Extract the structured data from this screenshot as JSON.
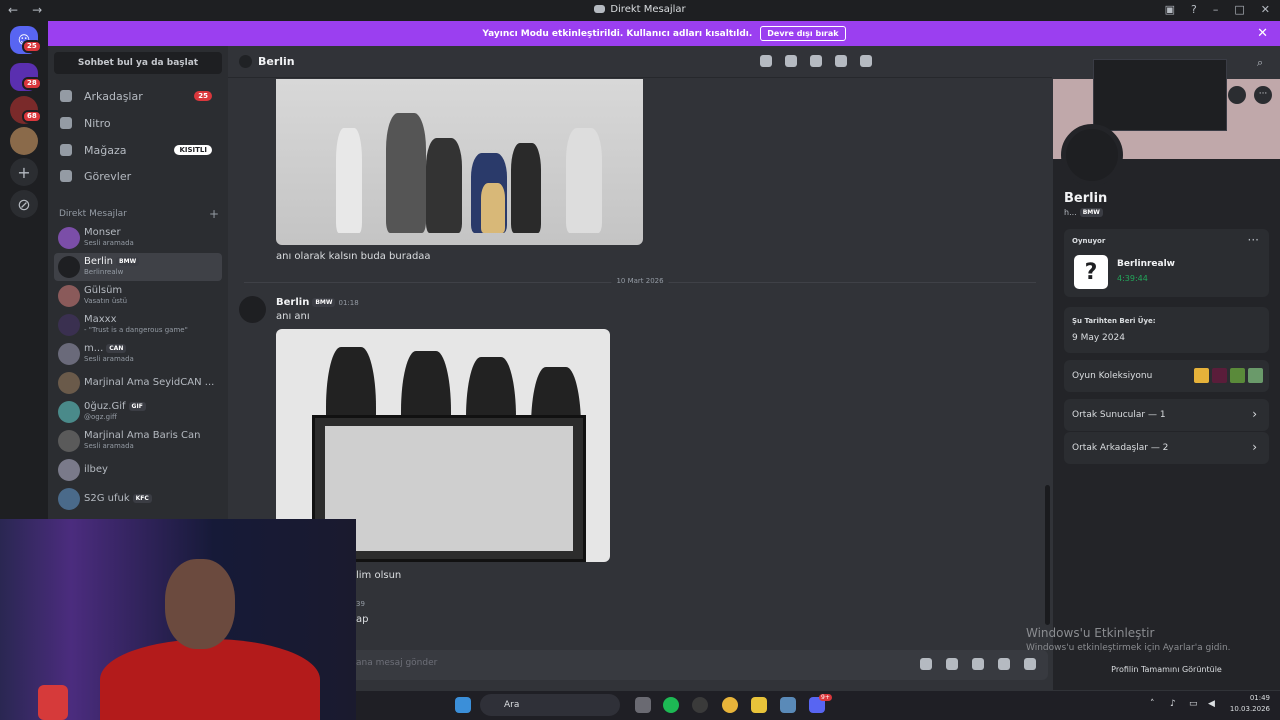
{
  "window": {
    "title": "Direkt Mesajlar"
  },
  "banner": {
    "text": "Yayıncı Modu etkinleştirildi. Kullanıcı adları kısaltıldı.",
    "button": "Devre dışı bırak"
  },
  "rail": {
    "badges": [
      "25",
      "28",
      "68"
    ]
  },
  "sidebar": {
    "search": "Sohbet bul ya da başlat",
    "nav": [
      {
        "label": "Arkadaşlar",
        "badge": "25"
      },
      {
        "label": "Nitro"
      },
      {
        "label": "Mağaza",
        "badge": "KISITLI"
      },
      {
        "label": "Görevler"
      }
    ],
    "section": "Direkt Mesajlar",
    "dms": [
      {
        "name": "Monser",
        "status": "Sesli aramada"
      },
      {
        "name": "Berlin",
        "tag": "BMW",
        "status": "Berlinrealw"
      },
      {
        "name": "Gülsüm",
        "status": "Vasatın üstü"
      },
      {
        "name": "Maxxx",
        "status": "- \"Trust is a dangerous game\""
      },
      {
        "name": "m...",
        "tag": "CAN",
        "status": "Sesli aramada"
      },
      {
        "name": "Marjinal Ama SeyidCAN ...",
        "status": ""
      },
      {
        "name": "0ğuz.Gif",
        "tag": "GIF",
        "status": "@ogz.giff"
      },
      {
        "name": "Marjinal Ama Baris Can",
        "status": "Sesli aramada"
      },
      {
        "name": "ilbey",
        "status": ""
      },
      {
        "name": "S2G ufuk",
        "tag": "KFC",
        "status": ""
      }
    ]
  },
  "channel": {
    "name": "Berlin"
  },
  "messages": {
    "caption1": "anı olarak kalsın buda buradaa",
    "date": "10 Mart 2026",
    "author": "Berlin",
    "author_tag": "BMW",
    "time": "01:18",
    "text2": "anı anı",
    "text3": "lim olsun",
    "text4_time": "39",
    "text4": "ap"
  },
  "composer": {
    "placeholder": "ana mesaj gönder"
  },
  "profile": {
    "name": "Berlin",
    "handle": "h...",
    "tag": "BMW",
    "playing_label": "Oynuyor",
    "game_name": "Berlinrealw",
    "game_time": "4:39:44",
    "member_label": "Şu Tarihten Beri Üye:",
    "member_since": "9 May 2024",
    "collection": "Oyun Koleksiyonu",
    "servers": "Ortak Sunucular — 1",
    "friends": "Ortak Arkadaşlar — 2",
    "footer": "Profilin Tamamını Görüntüle"
  },
  "watermark": {
    "title": "Windows'u Etkinleştir",
    "sub": "Windows'u etkinleştirmek için Ayarlar'a gidin."
  },
  "taskbar": {
    "search": "Ara",
    "time": "01:49",
    "date": "10.03.2026",
    "discord_badge": "9+"
  },
  "colors": {
    "accent": "#5865f2",
    "banner": "#9b3ff0",
    "danger": "#da373c",
    "online": "#23a55a"
  }
}
